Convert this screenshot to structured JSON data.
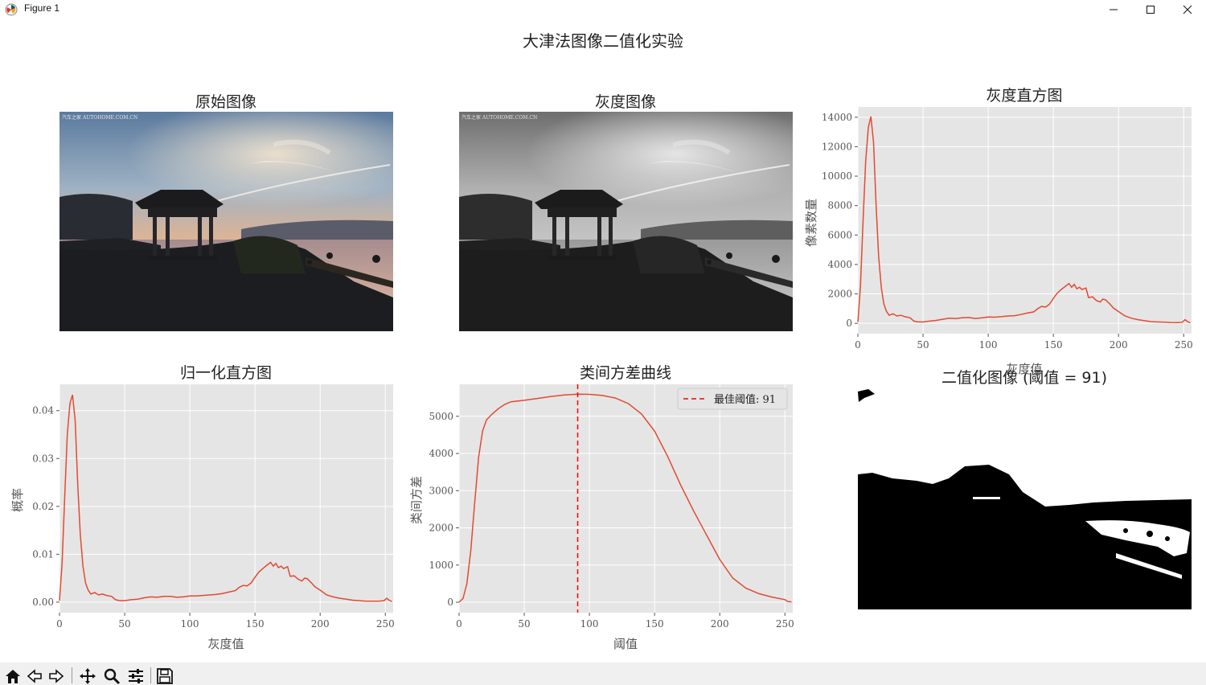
{
  "window": {
    "title": "Figure 1"
  },
  "figure": {
    "suptitle": "大津法图像二值化实验"
  },
  "panels": {
    "original": {
      "title": "原始图像",
      "watermark": "汽车之家 AUTOHOME.COM.CN"
    },
    "gray": {
      "title": "灰度图像",
      "watermark": "汽车之家 AUTOHOME.COM.CN"
    },
    "binary": {
      "title": "二值化图像 (阈值 = 91)"
    }
  },
  "colors": {
    "line": "#e24a33",
    "axes_bg": "#e5e5e5",
    "grid": "#ffffff",
    "threshold_line": "#ff0000"
  },
  "chart_data": [
    {
      "type": "line",
      "title": "灰度直方图",
      "xlabel": "灰度值",
      "ylabel": "像素数量",
      "xlim": [
        0,
        256
      ],
      "ylim": [
        -700,
        14700
      ],
      "xticks": [
        0,
        50,
        100,
        150,
        200,
        250
      ],
      "yticks": [
        0,
        2000,
        4000,
        6000,
        8000,
        10000,
        12000,
        14000
      ],
      "grid": true,
      "points": [
        [
          0,
          100
        ],
        [
          2,
          2500
        ],
        [
          4,
          7000
        ],
        [
          6,
          11000
        ],
        [
          8,
          13300
        ],
        [
          10,
          14050
        ],
        [
          12,
          12300
        ],
        [
          14,
          8000
        ],
        [
          16,
          4500
        ],
        [
          18,
          2400
        ],
        [
          20,
          1300
        ],
        [
          22,
          800
        ],
        [
          24,
          550
        ],
        [
          27,
          650
        ],
        [
          30,
          500
        ],
        [
          33,
          550
        ],
        [
          36,
          450
        ],
        [
          40,
          380
        ],
        [
          43,
          150
        ],
        [
          46,
          100
        ],
        [
          50,
          90
        ],
        [
          55,
          150
        ],
        [
          60,
          200
        ],
        [
          65,
          280
        ],
        [
          70,
          350
        ],
        [
          75,
          320
        ],
        [
          80,
          380
        ],
        [
          85,
          400
        ],
        [
          90,
          330
        ],
        [
          95,
          370
        ],
        [
          100,
          430
        ],
        [
          105,
          420
        ],
        [
          110,
          450
        ],
        [
          115,
          500
        ],
        [
          120,
          520
        ],
        [
          125,
          600
        ],
        [
          130,
          700
        ],
        [
          135,
          780
        ],
        [
          138,
          1000
        ],
        [
          141,
          1150
        ],
        [
          144,
          1100
        ],
        [
          147,
          1300
        ],
        [
          150,
          1700
        ],
        [
          153,
          2050
        ],
        [
          156,
          2300
        ],
        [
          159,
          2500
        ],
        [
          162,
          2700
        ],
        [
          164,
          2450
        ],
        [
          166,
          2650
        ],
        [
          168,
          2350
        ],
        [
          170,
          2450
        ],
        [
          172,
          2300
        ],
        [
          175,
          2400
        ],
        [
          177,
          1750
        ],
        [
          180,
          1800
        ],
        [
          183,
          1550
        ],
        [
          186,
          1450
        ],
        [
          188,
          1650
        ],
        [
          190,
          1600
        ],
        [
          193,
          1350
        ],
        [
          196,
          1050
        ],
        [
          200,
          800
        ],
        [
          205,
          500
        ],
        [
          210,
          350
        ],
        [
          215,
          250
        ],
        [
          220,
          180
        ],
        [
          225,
          120
        ],
        [
          230,
          100
        ],
        [
          235,
          80
        ],
        [
          240,
          60
        ],
        [
          245,
          50
        ],
        [
          249,
          80
        ],
        [
          251,
          250
        ],
        [
          253,
          120
        ],
        [
          255,
          30
        ]
      ]
    },
    {
      "type": "line",
      "title": "归一化直方图",
      "xlabel": "灰度值",
      "ylabel": "概率",
      "xlim": [
        0,
        256
      ],
      "ylim": [
        -0.0022,
        0.0455
      ],
      "xticks": [
        0,
        50,
        100,
        150,
        200,
        250
      ],
      "yticks": [
        0.0,
        0.01,
        0.02,
        0.03,
        0.04
      ],
      "ytick_labels": [
        "0.00",
        "0.01",
        "0.02",
        "0.03",
        "0.04"
      ],
      "grid": true,
      "points": [
        [
          0,
          0.0003
        ],
        [
          2,
          0.008
        ],
        [
          4,
          0.022
        ],
        [
          6,
          0.035
        ],
        [
          8,
          0.0415
        ],
        [
          10,
          0.0433
        ],
        [
          12,
          0.038
        ],
        [
          14,
          0.0245
        ],
        [
          16,
          0.014
        ],
        [
          18,
          0.0075
        ],
        [
          20,
          0.004
        ],
        [
          22,
          0.0025
        ],
        [
          24,
          0.0017
        ],
        [
          27,
          0.002
        ],
        [
          30,
          0.0015
        ],
        [
          33,
          0.0017
        ],
        [
          36,
          0.0014
        ],
        [
          40,
          0.0012
        ],
        [
          43,
          0.0005
        ],
        [
          46,
          0.0003
        ],
        [
          50,
          0.0003
        ],
        [
          55,
          0.0005
        ],
        [
          60,
          0.0006
        ],
        [
          65,
          0.0009
        ],
        [
          70,
          0.0011
        ],
        [
          75,
          0.001
        ],
        [
          80,
          0.0012
        ],
        [
          85,
          0.0012
        ],
        [
          90,
          0.001
        ],
        [
          95,
          0.0011
        ],
        [
          100,
          0.0013
        ],
        [
          105,
          0.0013
        ],
        [
          110,
          0.0014
        ],
        [
          115,
          0.0015
        ],
        [
          120,
          0.0016
        ],
        [
          125,
          0.0018
        ],
        [
          130,
          0.0021
        ],
        [
          135,
          0.0024
        ],
        [
          138,
          0.0031
        ],
        [
          141,
          0.0035
        ],
        [
          144,
          0.0034
        ],
        [
          147,
          0.004
        ],
        [
          150,
          0.0052
        ],
        [
          153,
          0.0063
        ],
        [
          156,
          0.007
        ],
        [
          159,
          0.0077
        ],
        [
          162,
          0.0083
        ],
        [
          164,
          0.0075
        ],
        [
          166,
          0.0081
        ],
        [
          168,
          0.0072
        ],
        [
          170,
          0.0075
        ],
        [
          172,
          0.007
        ],
        [
          175,
          0.0074
        ],
        [
          177,
          0.0054
        ],
        [
          180,
          0.0055
        ],
        [
          183,
          0.0048
        ],
        [
          186,
          0.0044
        ],
        [
          188,
          0.005
        ],
        [
          190,
          0.0049
        ],
        [
          193,
          0.0041
        ],
        [
          196,
          0.0032
        ],
        [
          200,
          0.0025
        ],
        [
          205,
          0.0015
        ],
        [
          210,
          0.0011
        ],
        [
          215,
          0.0008
        ],
        [
          220,
          0.0006
        ],
        [
          225,
          0.0004
        ],
        [
          230,
          0.0003
        ],
        [
          235,
          0.0002
        ],
        [
          240,
          0.0002
        ],
        [
          245,
          0.0002
        ],
        [
          249,
          0.0003
        ],
        [
          251,
          0.0008
        ],
        [
          253,
          0.0004
        ],
        [
          255,
          0.0001
        ]
      ]
    },
    {
      "type": "line",
      "title": "类间方差曲线",
      "xlabel": "阈值",
      "ylabel": "类间方差",
      "xlim": [
        0,
        256
      ],
      "ylim": [
        -280,
        5860
      ],
      "xticks": [
        0,
        50,
        100,
        150,
        200,
        250
      ],
      "yticks": [
        0,
        1000,
        2000,
        3000,
        4000,
        5000
      ],
      "grid": true,
      "legend": {
        "label": "最佳阈值: 91",
        "placement": "top-right"
      },
      "threshold": 91,
      "points": [
        [
          0,
          0
        ],
        [
          3,
          100
        ],
        [
          6,
          500
        ],
        [
          9,
          1400
        ],
        [
          12,
          2700
        ],
        [
          15,
          3900
        ],
        [
          18,
          4600
        ],
        [
          21,
          4900
        ],
        [
          25,
          5050
        ],
        [
          30,
          5200
        ],
        [
          35,
          5320
        ],
        [
          40,
          5390
        ],
        [
          50,
          5430
        ],
        [
          60,
          5480
        ],
        [
          70,
          5530
        ],
        [
          80,
          5570
        ],
        [
          91,
          5595
        ],
        [
          100,
          5590
        ],
        [
          110,
          5560
        ],
        [
          120,
          5490
        ],
        [
          130,
          5340
        ],
        [
          140,
          5060
        ],
        [
          150,
          4600
        ],
        [
          160,
          3920
        ],
        [
          170,
          3150
        ],
        [
          180,
          2450
        ],
        [
          190,
          1800
        ],
        [
          200,
          1150
        ],
        [
          210,
          650
        ],
        [
          220,
          380
        ],
        [
          230,
          230
        ],
        [
          240,
          140
        ],
        [
          250,
          70
        ],
        [
          252,
          20
        ],
        [
          255,
          10
        ]
      ]
    }
  ]
}
